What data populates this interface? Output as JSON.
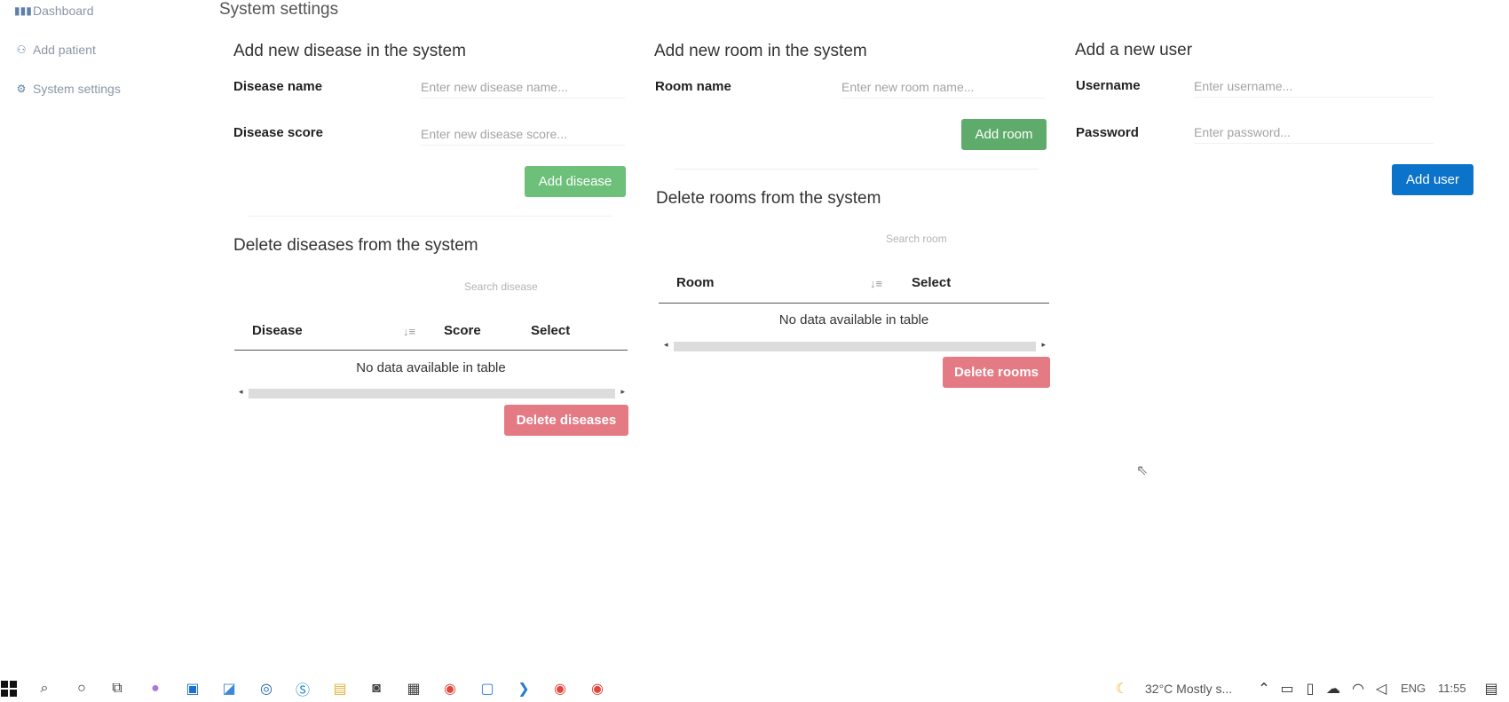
{
  "sidebar": {
    "items": [
      {
        "label": "Dashboard",
        "icon": "bar-chart-icon"
      },
      {
        "label": "Add patient",
        "icon": "add-user-icon"
      },
      {
        "label": "System settings",
        "icon": "users-gear-icon"
      }
    ]
  },
  "page": {
    "title": "System settings"
  },
  "disease": {
    "add_heading": "Add new disease in the system",
    "name_label": "Disease name",
    "name_placeholder": "Enter new disease name...",
    "score_label": "Disease score",
    "score_placeholder": "Enter new disease score...",
    "add_button": "Add disease",
    "delete_heading": "Delete diseases from the system",
    "search_placeholder": "Search disease",
    "columns": [
      "Disease",
      "Score",
      "Select"
    ],
    "empty_text": "No data available in table",
    "delete_button": "Delete diseases"
  },
  "room": {
    "add_heading": "Add new room in the system",
    "name_label": "Room name",
    "name_placeholder": "Enter new room name...",
    "add_button": "Add room",
    "delete_heading": "Delete rooms from the system",
    "search_placeholder": "Search room",
    "columns": [
      "Room",
      "Select"
    ],
    "empty_text": "No data available in table",
    "delete_button": "Delete rooms"
  },
  "user": {
    "add_heading": "Add a new user",
    "username_label": "Username",
    "username_placeholder": "Enter username...",
    "password_label": "Password",
    "password_placeholder": "Enter password...",
    "add_button": "Add user"
  },
  "taskbar": {
    "weather": "32°C  Mostly s...",
    "language": "ENG",
    "time": "11:55"
  }
}
